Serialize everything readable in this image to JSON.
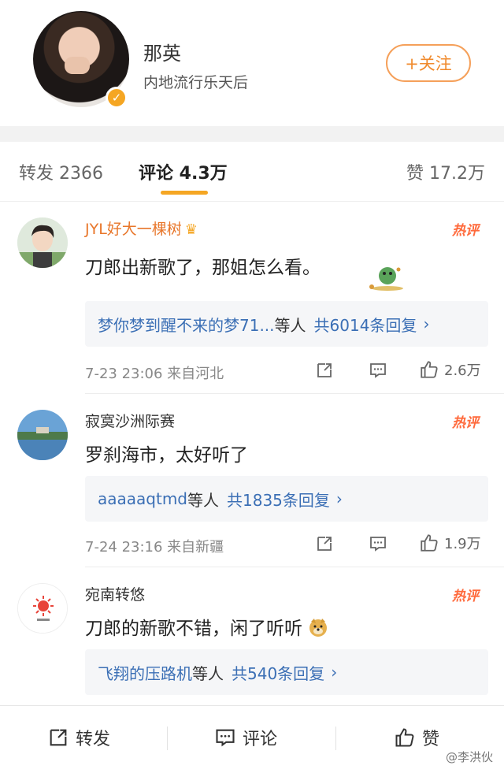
{
  "profile": {
    "name": "那英",
    "description": "内地流行乐天后",
    "follow_label": "+关注"
  },
  "tabs": {
    "repost": "转发 2366",
    "comments": "评论 4.3万",
    "likes": "赞 17.2万"
  },
  "comments": [
    {
      "user": "JYL好大一棵树",
      "badge": "热评",
      "text": "刀郎出新歌了，那姐怎么看。",
      "replies_names": "梦你梦到醒不来的梦71...",
      "replies_mid": "等人",
      "replies_count": "共6014条回复",
      "meta": "7-23 23:06 来自河北",
      "like_count": "2.6万"
    },
    {
      "user": "寂寞沙洲际赛",
      "badge": "热评",
      "text": "罗刹海市，太好听了",
      "replies_names": "aaaaaqtmd",
      "replies_mid": "等人",
      "replies_count": "共1835条回复",
      "meta": "7-24 23:16 来自新疆",
      "like_count": "1.9万"
    },
    {
      "user": "宛南转悠",
      "badge": "热评",
      "text": "刀郎的新歌不错，闲了听听",
      "replies_names": "飞翔的压路机",
      "replies_mid": "等人",
      "replies_count": "共540条回复"
    }
  ],
  "bottom_bar": {
    "repost": "转发",
    "comment": "评论",
    "like": "赞"
  },
  "watermark": "@李洪伙",
  "colors": {
    "accent": "#f5a623",
    "link": "#3b6fb5",
    "hot": "#ff6a3c"
  }
}
